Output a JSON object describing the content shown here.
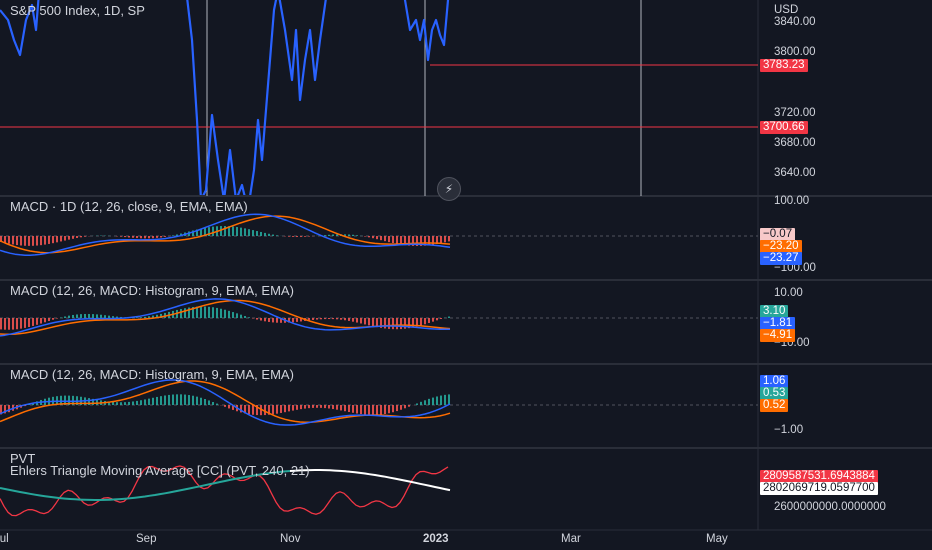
{
  "main": {
    "title": "S&P 500 Index, 1D, SP",
    "unit": "USD",
    "price_ticks": [
      "3840.00",
      "3800.00",
      "3720.00",
      "3680.00",
      "3640.00"
    ],
    "badge_upper": "3783.23",
    "badge_lower": "3700.66"
  },
  "pane1": {
    "title": "MACD · 1D (12, 26, close, 9, EMA, EMA)",
    "ticks": [
      "100.00",
      "−100.00"
    ],
    "values": [
      "−0.07",
      "−23.20",
      "−23.27"
    ]
  },
  "pane2": {
    "title": "MACD (12, 26, MACD: Histogram, 9, EMA, EMA)",
    "ticks": [
      "10.00",
      "−10.00"
    ],
    "values": [
      "3.10",
      "−1.81",
      "−4.91"
    ]
  },
  "pane3": {
    "title": "MACD (12, 26, MACD: Histogram, 9, EMA, EMA)",
    "ticks": [
      "−1.00"
    ],
    "values": [
      "1.06",
      "0.53",
      "0.52"
    ]
  },
  "pane4": {
    "title1": "PVT",
    "title2": "Ehlers Triangle Moving Average [CC] (PVT, 240, 21)",
    "tick": "2600000000.0000000",
    "values": [
      "2809587531.6943884",
      "2802069719.0597700"
    ]
  },
  "x_axis": [
    "Jul",
    "Sep",
    "Nov",
    "2023",
    "Mar",
    "May"
  ],
  "colors": {
    "background": "#131722",
    "price_line": "#2962ff",
    "macd_line": "#2962ff",
    "signal_line": "#ff6d00",
    "hist_up": "#26a69a",
    "hist_down": "#ef5350",
    "pvt_line": "#f23645",
    "etma_up": "#26a69a",
    "etma_down": "#ffffff"
  },
  "icons": [
    "bolt-icon"
  ]
}
